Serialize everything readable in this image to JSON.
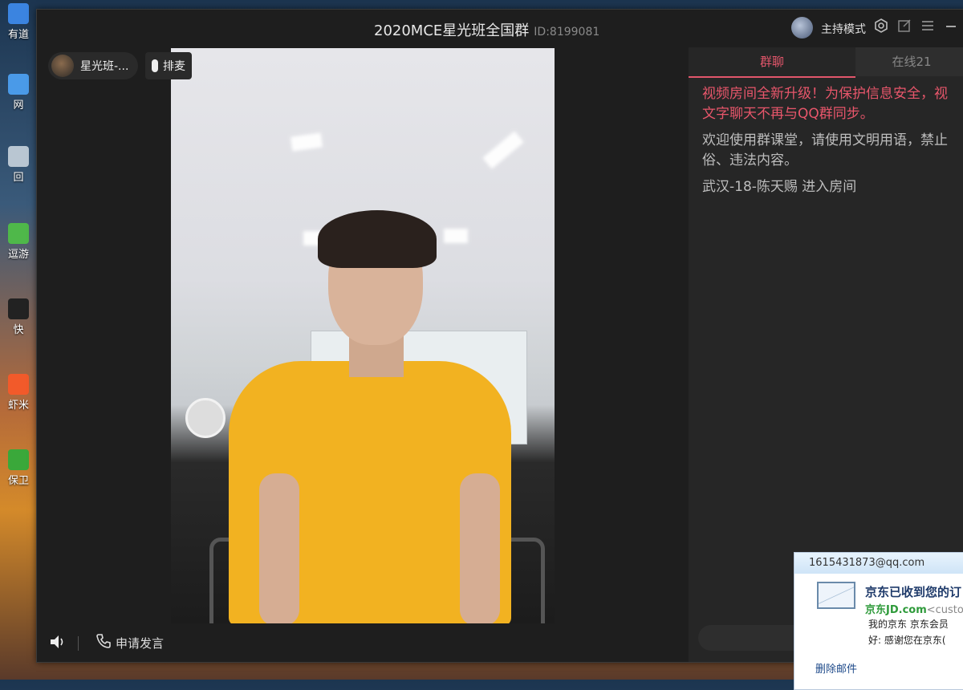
{
  "desktop": {
    "icons": [
      {
        "label": "有道"
      },
      {
        "label": "网"
      },
      {
        "label": "回"
      },
      {
        "label": "逗游"
      },
      {
        "label": "快"
      },
      {
        "label": "虾米"
      },
      {
        "label": "保卫"
      }
    ]
  },
  "window": {
    "title": "2020MCE星光班全国群",
    "room_id": "ID:8199081",
    "host_mode_label": "主持模式",
    "icons": [
      "settings-icon",
      "popout-icon",
      "menu-icon",
      "minimize-icon"
    ]
  },
  "video": {
    "room_name": "星光班-...",
    "queue_label": "排麦",
    "apply_label": "申请发言"
  },
  "chat": {
    "tabs": [
      {
        "label": "群聊",
        "active": true
      },
      {
        "label": "在线21",
        "active": false
      }
    ],
    "messages": [
      {
        "type": "notice",
        "line1": "视频房间全新升级！为保护信息安全，视",
        "line2": "文字聊天不再与QQ群同步。"
      },
      {
        "type": "info",
        "line1": "欢迎使用群课堂，请使用文明用语，禁止",
        "line2": "俗、违法内容。"
      },
      {
        "type": "info",
        "line1": "武汉-18-陈天赐 进入房间"
      }
    ]
  },
  "mail_notification": {
    "account": "1615431873@qq.com",
    "subject": "京东已收到您的订",
    "sender_name": "京东JD.com",
    "sender_addr": "<custo",
    "body_line1": "我的京东  京东会员",
    "body_line2": "好:  感谢您在京东(",
    "delete_label": "删除邮件"
  },
  "colors": {
    "accent": "#e2566b",
    "window_bg": "#1e1e1e",
    "shirt": "#f2b221"
  }
}
